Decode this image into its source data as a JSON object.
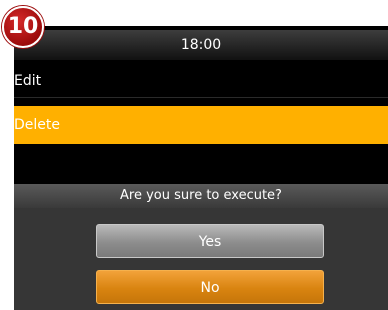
{
  "step_badge": "10",
  "status_bar": {
    "time": "18:00"
  },
  "menu": {
    "items": [
      {
        "label": "Edit"
      },
      {
        "label": "Delete"
      }
    ]
  },
  "dialog": {
    "prompt": "Are you sure to execute?",
    "yes_label": "Yes",
    "no_label": "No"
  },
  "colors": {
    "selected_row": "#ffb000",
    "no_button": "#d98410",
    "yes_button": "#8d8d8d",
    "badge": "#b01515"
  }
}
